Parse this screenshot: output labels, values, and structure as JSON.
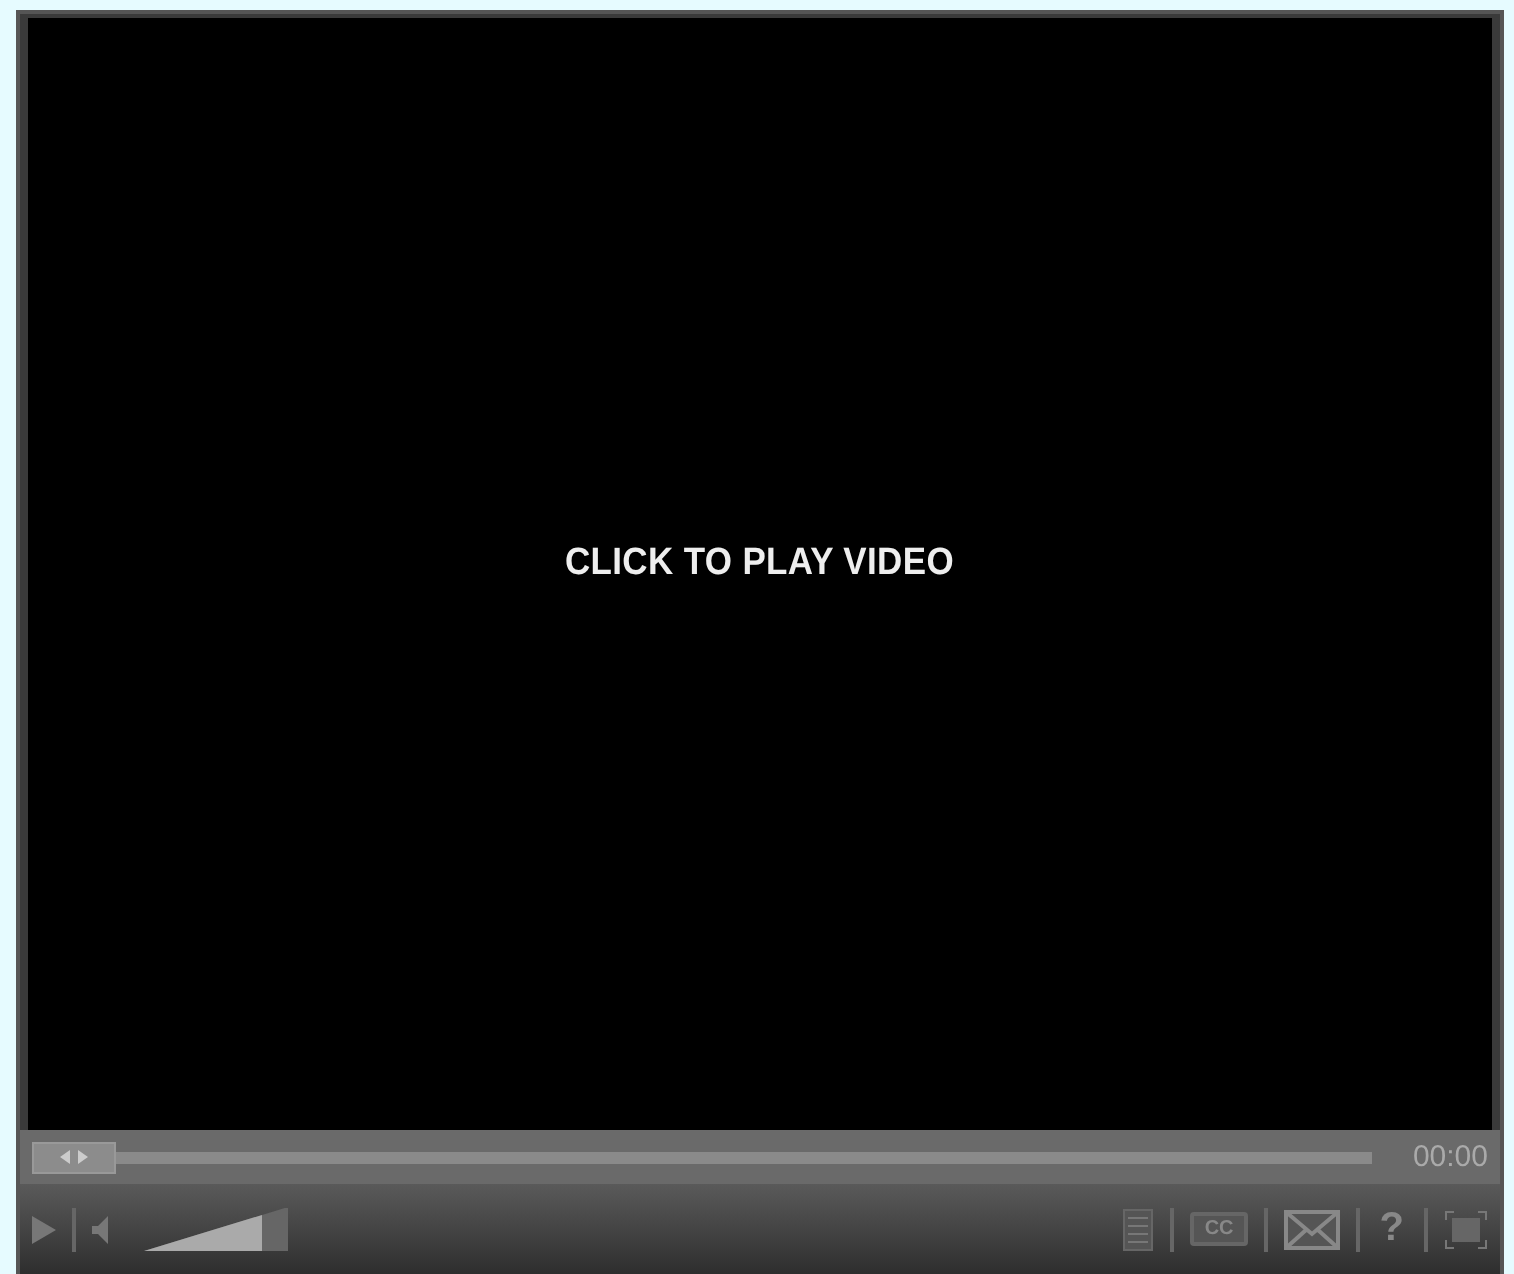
{
  "video": {
    "prompt": "CLICK TO PLAY VIDEO"
  },
  "seek": {
    "level": 0,
    "time": "00:00"
  },
  "volume": {
    "level": 0.82
  },
  "tools": [
    {
      "kind": "transcript"
    },
    {
      "kind": "captions",
      "label": "CC"
    },
    {
      "kind": "email"
    },
    {
      "kind": "help",
      "label": "?"
    },
    {
      "kind": "fullscreen"
    }
  ]
}
